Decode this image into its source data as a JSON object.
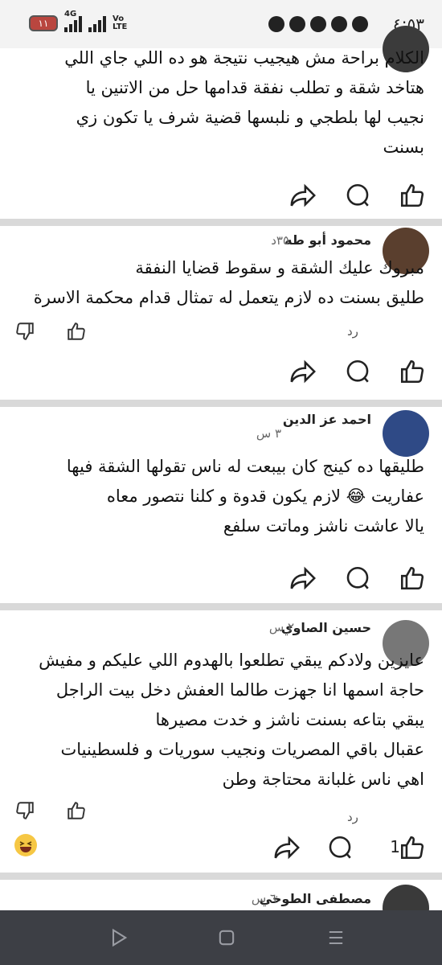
{
  "status_bar": {
    "time": "٤:٥٣",
    "battery": "١١",
    "network_4g": "4G",
    "network_volte": "Vo LTE"
  },
  "comments": [
    {
      "lines": [
        "الكلام براحة مش هيجيب نتيجة هو ده اللي جاي اللي",
        "هتاخد شقة و تطلب نفقة قدامها حل من الاتنين يا",
        "نجيب لها بلطجي و نلبسها قضية شرف يا تكون زي",
        "بسنت"
      ]
    },
    {
      "author": "محمود أبو طه",
      "time": "٣٥د",
      "lines": [
        "مبروك عليك الشقة و  سقوط قضايا النفقة",
        "طليق بسنت ده لازم يتعمل له تمثال قدام محكمة الاسرة"
      ],
      "reply": "رد"
    },
    {
      "author": "احمد عز الدين",
      "time": "٣ س",
      "lines": [
        "طليقها ده كينج كان بيبعت له ناس تقولها الشقة فيها",
        "عفاريت 😂 لازم يكون قدوة و كلنا نتصور معاه",
        "يالا عاشت ناشز وماتت سلفع"
      ]
    },
    {
      "author": "حسين الصاوي",
      "time": "٢ س",
      "lines": [
        "عايزين ولادكم يبقي تطلعوا بالهدوم اللي عليكم و مفيش",
        "حاجة اسمها انا جهزت طالما العفش دخل بيت الراجل",
        "يبقي بتاعه بسنت ناشز و خدت مصيرها",
        "عقبال باقي المصريات ونجيب سوريات و فلسطينيات",
        "اهي ناس غلبانة محتاجة وطن"
      ],
      "reply": "رد",
      "like_count": "1"
    },
    {
      "author": "مصطفى الطوخي",
      "time": "٦ س"
    }
  ],
  "colors": {
    "card": "#ffffff",
    "divider": "#d9d9d9",
    "navbar": "#3d3f45",
    "battery": "#b9463f"
  }
}
